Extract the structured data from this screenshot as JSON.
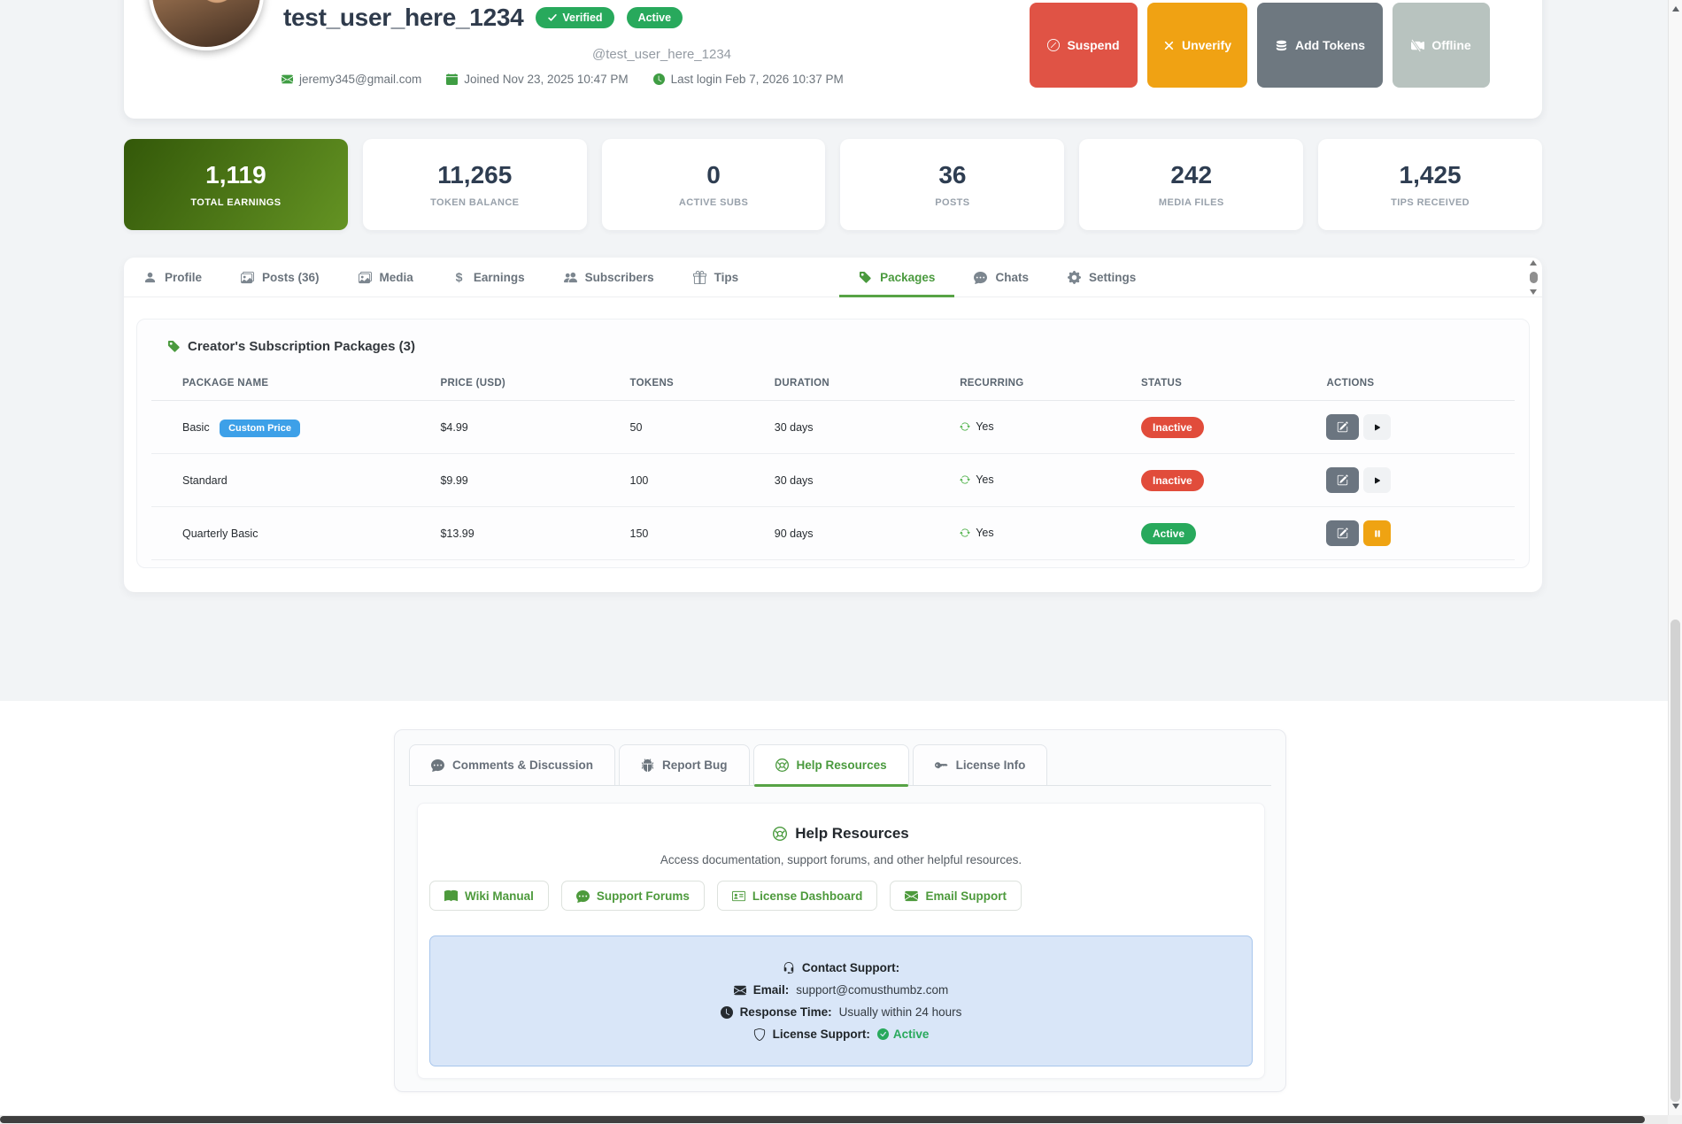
{
  "profile": {
    "username": "test_user_here_1234",
    "verified_badge": "Verified",
    "active_badge": "Active",
    "handle": "@test_user_here_1234",
    "email": "jeremy345@gmail.com",
    "joined": "Joined Nov 23, 2025 10:47 PM",
    "last_login": "Last login Feb 7, 2026 10:37 PM",
    "actions": {
      "suspend": "Suspend",
      "unverify": "Unverify",
      "add_tokens": "Add Tokens",
      "offline": "Offline"
    }
  },
  "stats": [
    {
      "value": "1,119",
      "label": "TOTAL EARNINGS"
    },
    {
      "value": "11,265",
      "label": "TOKEN BALANCE"
    },
    {
      "value": "0",
      "label": "ACTIVE SUBS"
    },
    {
      "value": "36",
      "label": "POSTS"
    },
    {
      "value": "242",
      "label": "MEDIA FILES"
    },
    {
      "value": "1,425",
      "label": "TIPS RECEIVED"
    }
  ],
  "tabs": [
    {
      "label": "Profile"
    },
    {
      "label": "Posts (36)"
    },
    {
      "label": "Media"
    },
    {
      "label": "Earnings"
    },
    {
      "label": "Subscribers"
    },
    {
      "label": "Tips"
    },
    {
      "label": "Packages"
    },
    {
      "label": "Chats"
    },
    {
      "label": "Settings"
    }
  ],
  "packages": {
    "title": "Creator's Subscription Packages (3)",
    "columns": [
      "PACKAGE NAME",
      "PRICE (USD)",
      "TOKENS",
      "DURATION",
      "RECURRING",
      "STATUS",
      "ACTIONS"
    ],
    "rows": [
      {
        "name": "Basic",
        "badge": "Custom Price",
        "price": "$4.99",
        "tokens": "50",
        "duration": "30 days",
        "recurring": "Yes",
        "status": "Inactive"
      },
      {
        "name": "Standard",
        "price": "$9.99",
        "tokens": "100",
        "duration": "30 days",
        "recurring": "Yes",
        "status": "Inactive"
      },
      {
        "name": "Quarterly Basic",
        "price": "$13.99",
        "tokens": "150",
        "duration": "90 days",
        "recurring": "Yes",
        "status": "Active"
      }
    ]
  },
  "support": {
    "tabs": [
      {
        "label": "Comments & Discussion"
      },
      {
        "label": "Report Bug"
      },
      {
        "label": "Help Resources"
      },
      {
        "label": "License Info"
      }
    ],
    "heading": "Help Resources",
    "subtitle": "Access documentation, support forums, and other helpful resources.",
    "buttons": [
      "Wiki Manual",
      "Support Forums",
      "License Dashboard",
      "Email Support"
    ],
    "contact": {
      "title": "Contact Support:",
      "email_label": "Email:",
      "email": "support@comusthumbz.com",
      "response_label": "Response Time:",
      "response": "Usually within 24 hours",
      "license_label": "License Support:",
      "license_status": "Active"
    }
  },
  "colors": {
    "accent_green": "#4a9a3e",
    "badge_green": "#28a95c",
    "danger_red": "#e14c3b",
    "warning_orange": "#f0a213",
    "info_blue_badge": "#3da0e8",
    "contact_box_bg": "#d9e6f8",
    "earnings_gradient_start": "#335809",
    "earnings_gradient_end": "#649323"
  }
}
